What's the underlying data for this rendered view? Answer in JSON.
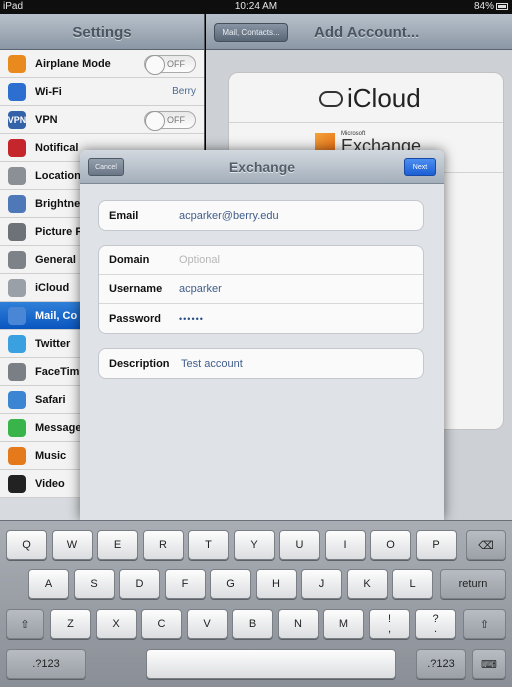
{
  "status": {
    "carrier": "iPad",
    "time": "10:24 AM",
    "battery": "84%"
  },
  "master": {
    "title": "Settings",
    "rows": [
      {
        "label": "Airplane Mode",
        "icon": "airplane-icon",
        "color": "#e98a1f",
        "toggle": "OFF"
      },
      {
        "label": "Wi-Fi",
        "icon": "wifi-icon",
        "color": "#2c6fd0",
        "value": "Berry"
      },
      {
        "label": "VPN",
        "icon": "vpn-icon",
        "color": "#3462a8",
        "toggle": "OFF",
        "iconText": "VPN"
      },
      {
        "label": "Notifical",
        "icon": "notifications-icon",
        "color": "#c4262c"
      },
      {
        "label": "Location",
        "icon": "location-icon",
        "color": "#8b8f96"
      },
      {
        "label": "Brightne",
        "icon": "brightness-icon",
        "color": "#4f78b8"
      },
      {
        "label": "Picture F",
        "icon": "picture-frame-icon",
        "color": "#6d7178"
      },
      {
        "label": "General",
        "icon": "gear-icon",
        "color": "#7d8288"
      },
      {
        "label": "iCloud",
        "icon": "cloud-icon",
        "color": "#9aa0a8"
      },
      {
        "label": "Mail, Co",
        "icon": "mail-icon",
        "color": "#4a86d6",
        "selected": true
      },
      {
        "label": "Twitter",
        "icon": "twitter-icon",
        "color": "#3aa0e0"
      },
      {
        "label": "FaceTim",
        "icon": "facetime-icon",
        "color": "#7a7f86"
      },
      {
        "label": "Safari",
        "icon": "safari-icon",
        "color": "#3b85d2"
      },
      {
        "label": "Message",
        "icon": "message-icon",
        "color": "#38b44a"
      },
      {
        "label": "Music",
        "icon": "music-icon",
        "color": "#e47a1c"
      },
      {
        "label": "Video",
        "icon": "video-icon",
        "color": "#222222"
      }
    ]
  },
  "detail": {
    "back": "Mail, Contacts...",
    "title": "Add Account...",
    "icloud": "iCloud",
    "ms_small": "Microsoft",
    "exchange": "Exchange"
  },
  "modal": {
    "cancel": "Cancel",
    "title": "Exchange",
    "next": "Next",
    "email_label": "Email",
    "email_value": "acparker@berry.edu",
    "domain_label": "Domain",
    "domain_placeholder": "Optional",
    "username_label": "Username",
    "username_value": "acparker",
    "password_label": "Password",
    "password_value": "••••••",
    "description_label": "Description",
    "description_value": "Test account"
  },
  "keyboard": {
    "row1": [
      "Q",
      "W",
      "E",
      "R",
      "T",
      "Y",
      "U",
      "I",
      "O",
      "P"
    ],
    "backspace": "⌫",
    "row2": [
      "A",
      "S",
      "D",
      "F",
      "G",
      "H",
      "J",
      "K",
      "L"
    ],
    "return": "return",
    "shift": "⇧",
    "row3": [
      "Z",
      "X",
      "C",
      "V",
      "B",
      "N",
      "M"
    ],
    "excl_top": "!",
    "excl_bottom": ",",
    "quest_top": "?",
    "quest_bottom": ".",
    "numbers": ".?123",
    "keyboard_hide": "⌨"
  }
}
